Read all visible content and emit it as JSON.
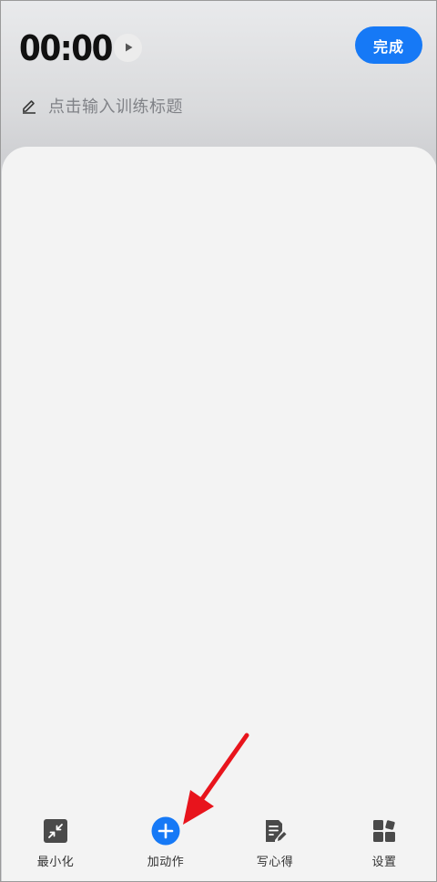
{
  "header": {
    "timer": "00:00",
    "done_label": "完成",
    "title_placeholder": "点击输入训练标题"
  },
  "icons": {
    "play": "play-icon",
    "edit": "pencil-icon",
    "minimize": "minimize-icon",
    "add": "add-circle-icon",
    "notes": "notes-icon",
    "settings": "settings-icon"
  },
  "bottom_nav": {
    "items": [
      {
        "label": "最小化",
        "icon": "minimize-icon"
      },
      {
        "label": "加动作",
        "icon": "add-circle-icon"
      },
      {
        "label": "写心得",
        "icon": "notes-icon"
      },
      {
        "label": "设置",
        "icon": "settings-icon"
      }
    ]
  },
  "colors": {
    "accent": "#1679f6",
    "annotation_arrow": "#e8141c"
  }
}
